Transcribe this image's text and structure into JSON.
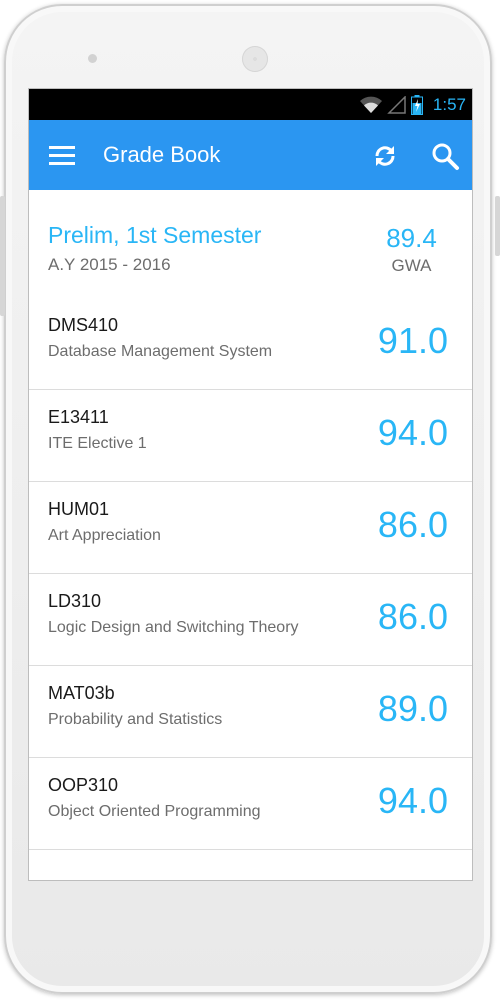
{
  "status_bar": {
    "time": "1:57",
    "icons": [
      "wifi-icon",
      "signal-icon",
      "battery-icon"
    ]
  },
  "app_bar": {
    "title": "Grade Book",
    "icons": [
      "menu-icon",
      "refresh-icon",
      "search-icon"
    ],
    "color": "#2b96f1"
  },
  "summary": {
    "term": "Prelim, 1st Semester",
    "academic_year": "A.Y 2015 - 2016",
    "gwa_value": "89.4",
    "gwa_label": "GWA"
  },
  "courses": [
    {
      "code": "DMS410",
      "name": "Database Management System",
      "grade": "91.0"
    },
    {
      "code": "E13411",
      "name": "ITE Elective 1",
      "grade": "94.0"
    },
    {
      "code": "HUM01",
      "name": "Art Appreciation",
      "grade": "86.0"
    },
    {
      "code": "LD310",
      "name": "Logic Design and Switching Theory",
      "grade": "86.0"
    },
    {
      "code": "MAT03b",
      "name": "Probability and Statistics",
      "grade": "89.0"
    },
    {
      "code": "OOP310",
      "name": "Object Oriented Programming",
      "grade": "94.0"
    }
  ],
  "colors": {
    "accent": "#29b6f6",
    "secondary_text": "#6d6d6d",
    "primary_text": "#1a1a1a"
  }
}
